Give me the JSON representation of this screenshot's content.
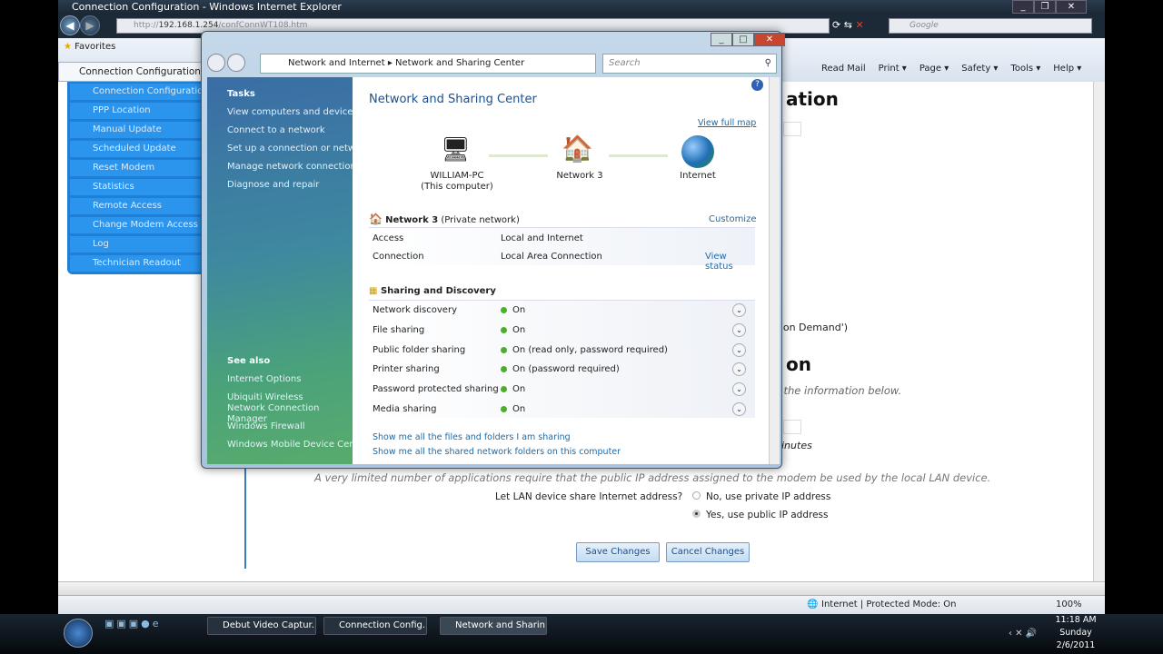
{
  "ie": {
    "title": "Connection Configuration - Windows Internet Explorer",
    "url_prefix": "http://",
    "url_host": "192.168.1.254",
    "url_path": "/confConnWT108.htm",
    "search_placeholder": "Google",
    "favorites": "Favorites",
    "tab": "Connection Configuration",
    "commands": [
      "Read Mail",
      "Print ▾",
      "Page ▾",
      "Safety ▾",
      "Tools ▾",
      "Help ▾"
    ],
    "status": "Internet | Protected Mode: On",
    "zoom": "100%"
  },
  "nav": [
    "Connection Configuration",
    "PPP Location",
    "Manual Update",
    "Scheduled Update",
    "Reset Modem",
    "Statistics",
    "Remote Access",
    "Change Modem Access C",
    "Log",
    "Technician Readout"
  ],
  "page": {
    "heading1": "ation",
    "demand": "ct on Demand')",
    "heading2": "on",
    "verify": "fy the information below.",
    "minutes": "inutes",
    "note": "A very limited number of applications require that the public IP address assigned to the modem be used by the local LAN device.",
    "question": "Let LAN device share Internet address?",
    "option_no": "No, use private IP address",
    "option_yes": "Yes, use public IP address",
    "save": "Save Changes",
    "cancel": "Cancel Changes"
  },
  "dialog": {
    "breadcrumb": [
      "Network and Internet",
      "Network and Sharing Center"
    ],
    "search_placeholder": "Search",
    "tasks_heading": "Tasks",
    "tasks": [
      "View computers and devices",
      "Connect to a network",
      "Set up a connection or network",
      "Manage network connections",
      "Diagnose and repair"
    ],
    "see_also_heading": "See also",
    "see_also": [
      "Internet Options",
      "Ubiquiti Wireless Network Connection Manager",
      "Windows Firewall",
      "Windows Mobile Device Center"
    ],
    "title": "Network and Sharing Center",
    "view_full_map": "View full map",
    "map": {
      "computer": "WILLIAM-PC",
      "computer_sub": "(This computer)",
      "network": "Network  3",
      "internet": "Internet"
    },
    "network_name": "Network  3",
    "network_type": "(Private network)",
    "customize": "Customize",
    "access_label": "Access",
    "access_value": "Local and Internet",
    "connection_label": "Connection",
    "connection_value": "Local Area Connection",
    "view_status": "View status",
    "sharing_heading": "Sharing and Discovery",
    "sharing": [
      {
        "label": "Network discovery",
        "value": "On"
      },
      {
        "label": "File sharing",
        "value": "On"
      },
      {
        "label": "Public folder sharing",
        "value": "On (read only, password required)"
      },
      {
        "label": "Printer sharing",
        "value": "On (password required)"
      },
      {
        "label": "Password protected sharing",
        "value": "On"
      },
      {
        "label": "Media sharing",
        "value": "On"
      }
    ],
    "link1": "Show me all the files and folders I am sharing",
    "link2": "Show me all the shared network folders on this computer"
  },
  "taskbar": {
    "items": [
      "Debut Video Captur...",
      "Connection Config...",
      "Network and Sharin..."
    ],
    "time": "11:18 AM",
    "day": "Sunday",
    "date": "2/6/2011"
  }
}
